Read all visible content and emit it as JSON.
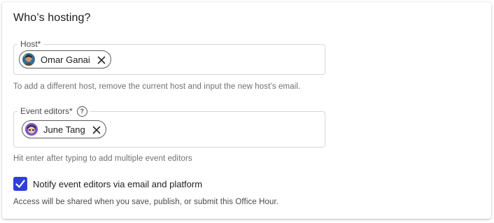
{
  "section": {
    "title": "Who’s hosting?"
  },
  "host_field": {
    "label": "Host*",
    "chip": {
      "name": "Omar Ganai",
      "avatar_icon": "person-avatar-icon",
      "remove_icon": "close-icon"
    },
    "helper": "To add a different host, remove the current host and input the new host’s email."
  },
  "editors_field": {
    "label": "Event editors*",
    "help_icon": "question-circle-icon",
    "chip": {
      "name": "June Tang",
      "avatar_icon": "person-avatar-icon",
      "remove_icon": "close-icon"
    },
    "helper": "Hit enter after typing to add multiple event editors"
  },
  "notify": {
    "checked": true,
    "label": "Notify event editors via email and platform"
  },
  "note": "Access will be shared when you save, publish, or submit this Office Hour.",
  "colors": {
    "accent": "#2f3fd8",
    "border": "#d6d6d6",
    "helper_text": "#707070"
  }
}
